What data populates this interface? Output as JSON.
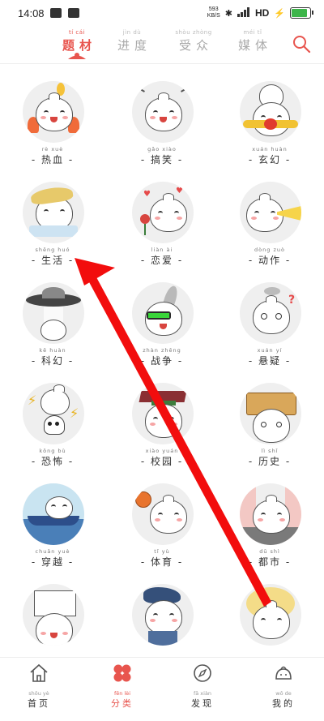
{
  "status_bar": {
    "time": "14:08",
    "speed_value": "593",
    "speed_unit": "KB/S",
    "hd": "HD"
  },
  "tabs": [
    {
      "pinyin": "tí cái",
      "label": "题材",
      "active": true
    },
    {
      "pinyin": "jìn dù",
      "label": "进度",
      "active": false
    },
    {
      "pinyin": "shòu zhòng",
      "label": "受众",
      "active": false
    },
    {
      "pinyin": "méi tǐ",
      "label": "媒体",
      "active": false
    }
  ],
  "categories": [
    {
      "pinyin": "rè xuè",
      "label": "热血",
      "icon": "fire-bun-icon"
    },
    {
      "pinyin": "gǎo xiào",
      "label": "搞笑",
      "icon": "laughing-bun-icon"
    },
    {
      "pinyin": "xuán huàn",
      "label": "玄幻",
      "icon": "fantasy-bun-icon"
    },
    {
      "pinyin": "shēng huó",
      "label": "生活",
      "icon": "sleeping-bun-icon"
    },
    {
      "pinyin": "liàn ài",
      "label": "恋爱",
      "icon": "rose-bun-icon"
    },
    {
      "pinyin": "dòng zuò",
      "label": "动作",
      "icon": "punch-bun-icon"
    },
    {
      "pinyin": "kē huàn",
      "label": "科幻",
      "icon": "ufo-bun-icon"
    },
    {
      "pinyin": "zhàn zhēng",
      "label": "战争",
      "icon": "soldier-bun-icon"
    },
    {
      "pinyin": "xuán yí",
      "label": "悬疑",
      "icon": "question-bun-icon"
    },
    {
      "pinyin": "kǒng bù",
      "label": "恐怖",
      "icon": "skull-bun-icon"
    },
    {
      "pinyin": "xiào yuán",
      "label": "校园",
      "icon": "graduate-bun-icon"
    },
    {
      "pinyin": "lì shǐ",
      "label": "历史",
      "icon": "history-bun-icon"
    },
    {
      "pinyin": "chuān yuè",
      "label": "穿越",
      "icon": "boat-bun-icon"
    },
    {
      "pinyin": "tǐ yù",
      "label": "体育",
      "icon": "basketball-bun-icon"
    },
    {
      "pinyin": "dū shì",
      "label": "都市",
      "icon": "city-bun-icon"
    },
    {
      "pinyin": "",
      "label": "",
      "icon": "book-bun-icon"
    },
    {
      "pinyin": "",
      "label": "",
      "icon": "rabbit-bun-icon"
    },
    {
      "pinyin": "",
      "label": "",
      "icon": "sun-bun-icon"
    }
  ],
  "bottom_nav": [
    {
      "pinyin": "shǒu yè",
      "label": "首页",
      "icon": "home-icon",
      "active": false
    },
    {
      "pinyin": "fēn lèi",
      "label": "分类",
      "icon": "category-icon",
      "active": true
    },
    {
      "pinyin": "fā xiàn",
      "label": "发现",
      "icon": "compass-icon",
      "active": false
    },
    {
      "pinyin": "wǒ de",
      "label": "我的",
      "icon": "profile-bun-icon",
      "active": false
    }
  ],
  "colors": {
    "accent": "#e8554e",
    "arrow": "#f20d0d",
    "circle_bg": "#efefef"
  }
}
